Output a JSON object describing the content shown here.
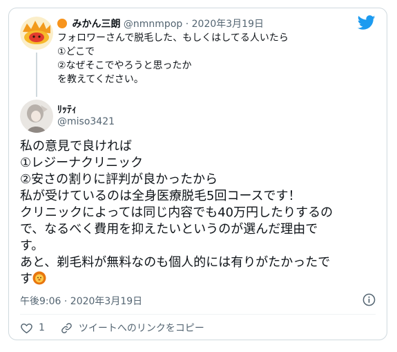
{
  "parent_tweet": {
    "display_name": "みかん三朗",
    "handle": "@nmnmpop",
    "separator": "·",
    "date": "2020年3月19日",
    "lines": [
      "フォロワーさんで脱毛した、もしくはしてる人いたら",
      "①どこで",
      "②なぜそこでやろうと思ったか",
      "を教えてください。"
    ]
  },
  "reply_tweet": {
    "display_name": "ﾘｯﾃｨ",
    "handle": "@miso3421",
    "lines": [
      "私の意見で良ければ",
      "①レジーナクリニック",
      "②安さの割りに評判が良かったから",
      "私が受けているのは全身医療脱毛5回コースです！",
      "クリニックによっては同じ内容でも40万円したりするの",
      "で、なるべく費用を抑えたいというのが選んだ理由で",
      "す。",
      "あと、剃毛料が無料なのも個人的には有りがたかったで",
      "す"
    ],
    "timestamp": "午後9:06 · 2020年3月19日"
  },
  "actions": {
    "like_count": "1",
    "copy_link_label": "ツイートへのリンクをコピー"
  },
  "icons": {
    "brand": "twitter-bird-icon",
    "info": "info-icon",
    "like": "heart-icon",
    "link": "link-icon",
    "lion": "lion-emoji-icon",
    "orange": "orange-emoji-icon"
  },
  "colors": {
    "brand_blue": "#1d9bf0",
    "text_primary": "#0f1419",
    "text_secondary": "#536471",
    "border": "#cfd9de"
  }
}
